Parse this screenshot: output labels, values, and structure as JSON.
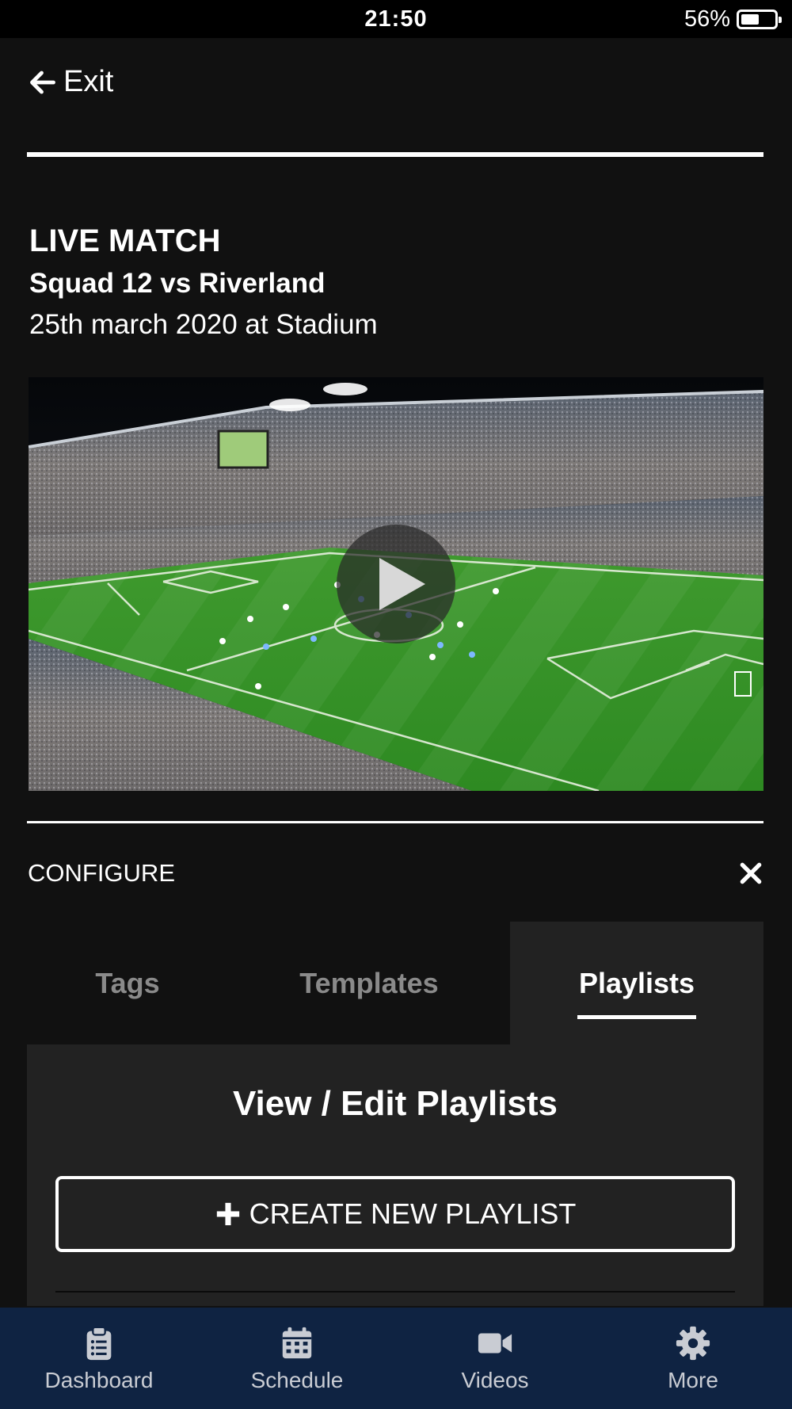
{
  "status_bar": {
    "time": "21:50",
    "battery_text": "56%",
    "battery_level": 0.56
  },
  "header": {
    "exit_label": "Exit"
  },
  "match": {
    "badge": "LIVE MATCH",
    "title": "Squad 12 vs Riverland",
    "subtitle": "25th march 2020 at Stadium"
  },
  "configure": {
    "label": "CONFIGURE",
    "tabs": [
      {
        "label": "Tags",
        "active": false
      },
      {
        "label": "Templates",
        "active": false
      },
      {
        "label": "Playlists",
        "active": true
      }
    ]
  },
  "panel": {
    "title": "View / Edit Playlists",
    "create_button_label": "CREATE NEW PLAYLIST"
  },
  "bottom_nav": {
    "items": [
      {
        "label": "Dashboard",
        "icon": "clipboard-icon"
      },
      {
        "label": "Schedule",
        "icon": "calendar-icon"
      },
      {
        "label": "Videos",
        "icon": "video-camera-icon"
      },
      {
        "label": "More",
        "icon": "gear-icon"
      }
    ]
  },
  "colors": {
    "background": "#111111",
    "panel": "#222222",
    "nav_background": "#0f2342",
    "inactive_tab": "#8a8a8a"
  }
}
